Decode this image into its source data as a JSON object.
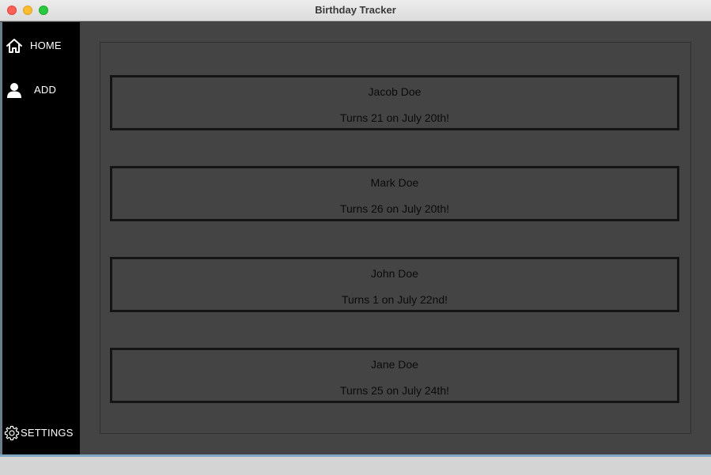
{
  "window": {
    "title": "Birthday Tracker"
  },
  "sidebar": {
    "items": [
      {
        "label": "HOME",
        "icon": "home-icon"
      },
      {
        "label": "ADD",
        "icon": "person-icon"
      },
      {
        "label": "SETTINGS",
        "icon": "gear-icon"
      }
    ]
  },
  "birthdays": [
    {
      "name": "Jacob Doe",
      "detail": "Turns 21 on July 20th!"
    },
    {
      "name": "Mark Doe",
      "detail": "Turns 26 on July 20th!"
    },
    {
      "name": "John Doe",
      "detail": "Turns 1 on July 22nd!"
    },
    {
      "name": "Jane Doe",
      "detail": "Turns 25 on July 24th!"
    }
  ],
  "colors": {
    "sidebar": "#000000",
    "content": "#444444",
    "card_border": "#141414"
  }
}
